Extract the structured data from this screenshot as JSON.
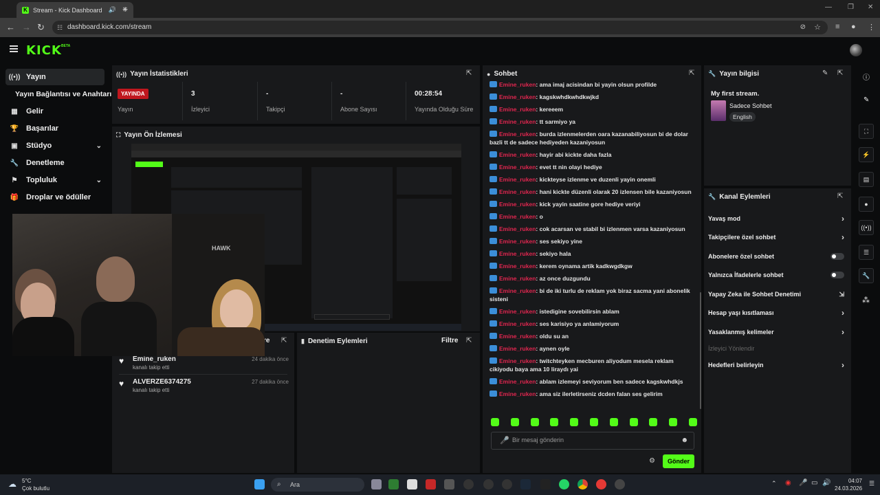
{
  "browser": {
    "tab_title": "Stream - Kick Dashboard",
    "url": "dashboard.kick.com/stream"
  },
  "header": {
    "logo": "KICK",
    "beta": "BETA"
  },
  "sidebar": {
    "items": [
      {
        "label": "Yayın",
        "icon": "broadcast-icon"
      },
      {
        "label": "Yayın Bağlantısı ve Anahtarı",
        "icon": ""
      },
      {
        "label": "Gelir",
        "icon": "chart-icon"
      },
      {
        "label": "Başarılar",
        "icon": "trophy-icon"
      },
      {
        "label": "Stüdyo",
        "icon": "studio-icon"
      },
      {
        "label": "Denetleme",
        "icon": "wrench-icon"
      },
      {
        "label": "Topluluk",
        "icon": "community-icon"
      },
      {
        "label": "Droplar ve ödüller",
        "icon": "gift-icon"
      }
    ]
  },
  "stats": {
    "title": "Yayın İstatistikleri",
    "live_badge": "YAYINDA",
    "items": [
      {
        "value": "",
        "label": "Yayın"
      },
      {
        "value": "3",
        "label": "İzleyici"
      },
      {
        "value": "-",
        "label": "Takipçi"
      },
      {
        "value": "-",
        "label": "Abone Sayısı"
      },
      {
        "value": "00:28:54",
        "label": "Yayında Olduğu Süre"
      }
    ]
  },
  "preview": {
    "title": "Yayın Ön İzlemesi",
    "webcam_text": "HAWK"
  },
  "follows": {
    "title_partial": "re",
    "items": [
      {
        "name": "Emine_ruken",
        "sub": "kanalı takip etti",
        "time": "24 dakika önce"
      },
      {
        "name": "ALVERZE6374275",
        "sub": "kanalı takip etti",
        "time": "27 dakika önce"
      }
    ]
  },
  "moderation": {
    "title": "Denetim Eylemleri",
    "filter": "Filtre"
  },
  "chat": {
    "title": "Sohbet",
    "messages": [
      {
        "user": "Emine_ruken",
        "text": "ama imaj acisindan bi yayin olsun profilde"
      },
      {
        "user": "Emine_ruken",
        "text": "kagskwhdkwhdkwjkd"
      },
      {
        "user": "Emine_ruken",
        "text": "kereeem"
      },
      {
        "user": "Emine_ruken",
        "text": "tt sarmiyo ya"
      },
      {
        "user": "Emine_ruken",
        "text": "burda izlenmelerden oara kazanabiliyosun bi de dolar bazli tt de sadece hediyeden kazaniyosun"
      },
      {
        "user": "Emine_ruken",
        "text": "hayir abi kickte daha fazla"
      },
      {
        "user": "Emine_ruken",
        "text": "evet tt nin olayi hediye"
      },
      {
        "user": "Emine_ruken",
        "text": "kickteyse izlenme ve duzenli yayin onemli"
      },
      {
        "user": "Emine_ruken",
        "text": "hani kickte düzenli olarak 20 izlensen bile kazaniyosun"
      },
      {
        "user": "Emine_ruken",
        "text": "kick yayin saatine gore hediye veriyi"
      },
      {
        "user": "Emine_ruken",
        "text": "o"
      },
      {
        "user": "Emine_ruken",
        "text": "cok acarsan ve stabil bi izlenmen varsa kazaniyosun"
      },
      {
        "user": "Emine_ruken",
        "text": "ses sekiyo yine"
      },
      {
        "user": "Emine_ruken",
        "text": "sekiyo hala"
      },
      {
        "user": "Emine_ruken",
        "text": "kerem oynama artik kadkwgdkgw"
      },
      {
        "user": "Emine_ruken",
        "text": "az once duzgundu"
      },
      {
        "user": "Emine_ruken",
        "text": "bi de iki turlu de reklam yok biraz sacma yani abonelik sisteni"
      },
      {
        "user": "Emine_ruken",
        "text": "istedigine sovebilirsin ablam"
      },
      {
        "user": "Emine_ruken",
        "text": "ses karisiyo ya anlamiyorum"
      },
      {
        "user": "Emine_ruken",
        "text": "oldu su an"
      },
      {
        "user": "Emine_ruken",
        "text": "aynen oyle"
      },
      {
        "user": "Emine_ruken",
        "text": "twitchteyken mecburen aliyodum mesela reklam cikiyodu baya ama 10 liraydı yai"
      },
      {
        "user": "Emine_ruken",
        "text": "ablam izlemeyi seviyorum ben sadece kagskwhdkjs"
      },
      {
        "user": "Emine_ruken",
        "text": "ama siz ilerletirseniz dcden falan ses gelirim"
      }
    ],
    "input_placeholder": "Bir mesaj gönderin",
    "send_label": "Gönder"
  },
  "stream_info": {
    "title": "Yayın bilgisi",
    "stream_title": "My first stream.",
    "category": "Sadece Sohbet",
    "language": "English"
  },
  "channel_actions": {
    "title": "Kanal Eylemleri",
    "items": [
      {
        "label": "Yavaş mod",
        "control": "arrow"
      },
      {
        "label": "Takipçilere özel sohbet",
        "control": "arrow"
      },
      {
        "label": "Abonelere özel sohbet",
        "control": "toggle"
      },
      {
        "label": "Yalnızca İfadelerle sohbet",
        "control": "toggle"
      },
      {
        "label": "Yapay Zeka ile Sohbet Denetimi",
        "control": "external"
      },
      {
        "label": "Hesap yaşı kısıtlaması",
        "control": "arrow"
      },
      {
        "label": "Yasaklanmış kelimeler",
        "control": "arrow"
      },
      {
        "label": "İzleyici Yönlendir",
        "control": "none",
        "disabled": true
      },
      {
        "label": "Hedefleri belirleyin",
        "control": "arrow"
      }
    ]
  },
  "taskbar": {
    "weather_temp": "5°C",
    "weather_text": "Çok bulutlu",
    "search_label": "Ara",
    "time": "04:07",
    "date": "24.03.2026"
  },
  "colors": {
    "accent": "#53fc18",
    "live": "#c0171e",
    "chat_user": "#e0264f"
  }
}
